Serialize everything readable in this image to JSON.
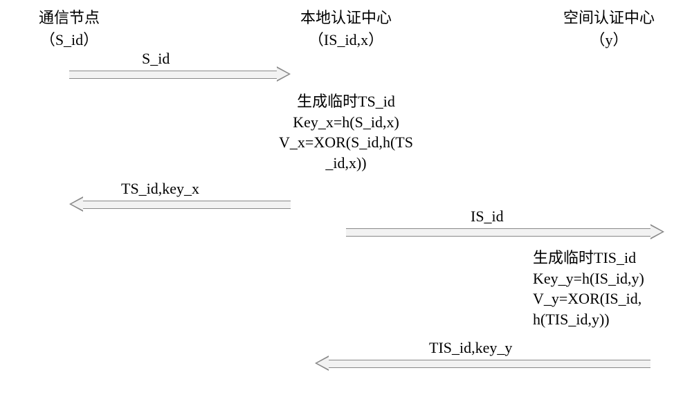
{
  "actors": {
    "node": {
      "title": "通信节点",
      "sub": "（S_id）"
    },
    "local": {
      "title": "本地认证中心",
      "sub": "（IS_id,x）"
    },
    "space": {
      "title": "空间认证中心",
      "sub": "（y）"
    }
  },
  "arrows": {
    "a1": "S_id",
    "a2": "TS_id,key_x",
    "a3": "IS_id",
    "a4": "TIS_id,key_y"
  },
  "blocks": {
    "b1": {
      "l1": "生成临时TS_id",
      "l2": "Key_x=h(S_id,x)",
      "l3": "V_x=XOR(S_id,h(TS",
      "l4": "_id,x))"
    },
    "b2": {
      "l1": "生成临时TIS_id",
      "l2": "Key_y=h(IS_id,y)",
      "l3": "V_y=XOR(IS_id,",
      "l4": "h(TIS_id,y))"
    }
  }
}
